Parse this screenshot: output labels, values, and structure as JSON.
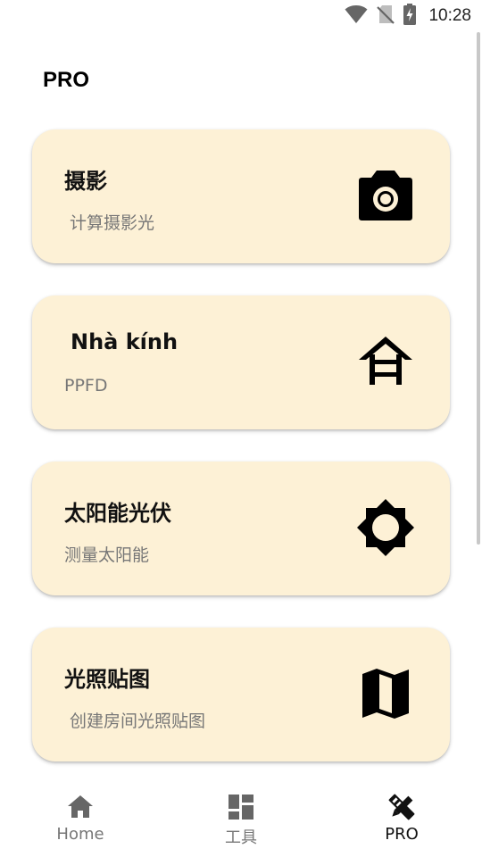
{
  "status_bar": {
    "time": "10:28",
    "icons": [
      "wifi-icon",
      "no-sim-icon",
      "battery-charging-icon"
    ]
  },
  "header": {
    "title": "PRO"
  },
  "cards": [
    {
      "title": "摄影",
      "subtitle": "计算摄影光",
      "icon": "camera-icon"
    },
    {
      "title": "Nhà kính",
      "subtitle": "PPFD",
      "icon": "greenhouse-icon"
    },
    {
      "title": "太阳能光伏",
      "subtitle": "测量太阳能",
      "icon": "brightness-icon"
    },
    {
      "title": "光照贴图",
      "subtitle": "创建房间光照贴图",
      "icon": "map-icon"
    }
  ],
  "bottom_nav": {
    "items": [
      {
        "label": "Home",
        "icon": "home-icon"
      },
      {
        "label": "工具",
        "icon": "dashboard-icon"
      },
      {
        "label": "PRO",
        "icon": "design-tools-icon"
      }
    ],
    "active_color": "#111111",
    "inactive_color": "#777777"
  },
  "colors": {
    "card_background": "#fdf1d6",
    "background": "#ffffff"
  }
}
